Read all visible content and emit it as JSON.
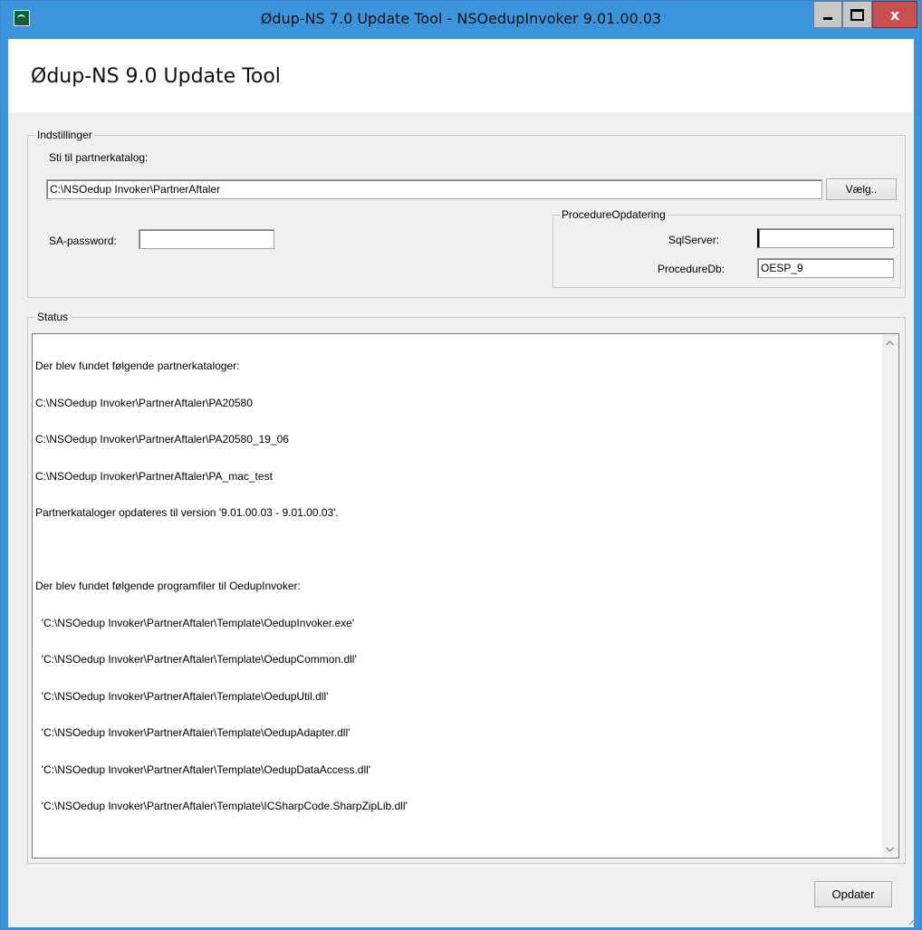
{
  "window": {
    "title": "Ødup-NS 7.0 Update Tool - NSOedupInvoker 9.01.00.03",
    "close_glyph": "x"
  },
  "header": {
    "title": "Ødup-NS 9.0 Update Tool"
  },
  "settings": {
    "legend": "Indstillinger",
    "path_label": "Sti til partnerkatalog:",
    "path_value": "C:\\NSOedup Invoker\\PartnerAftaler",
    "choose_button": "Vælg..",
    "sa_password_label": "SA-password:",
    "sa_password_value": ""
  },
  "procedure": {
    "legend": "ProcedureOpdatering",
    "sqlserver_label": "SqlServer:",
    "sqlserver_value": "",
    "proceduredb_label": "ProcedureDb:",
    "proceduredb_value": "OESP_9"
  },
  "status": {
    "legend": "Status",
    "lines": [
      "Der blev fundet følgende partnerkataloger:",
      "C:\\NSOedup Invoker\\PartnerAftaler\\PA20580",
      "C:\\NSOedup Invoker\\PartnerAftaler\\PA20580_19_06",
      "C:\\NSOedup Invoker\\PartnerAftaler\\PA_mac_test",
      "Partnerkataloger opdateres til version '9.01.00.03 - 9.01.00.03'.",
      "",
      "Der blev fundet følgende programfiler til OedupInvoker:",
      "  'C:\\NSOedup Invoker\\PartnerAftaler\\Template\\OedupInvoker.exe'",
      "  'C:\\NSOedup Invoker\\PartnerAftaler\\Template\\OedupCommon.dll'",
      "  'C:\\NSOedup Invoker\\PartnerAftaler\\Template\\OedupUtil.dll'",
      "  'C:\\NSOedup Invoker\\PartnerAftaler\\Template\\OedupAdapter.dll'",
      "  'C:\\NSOedup Invoker\\PartnerAftaler\\Template\\OedupDataAccess.dll'",
      "  'C:\\NSOedup Invoker\\PartnerAftaler\\Template\\ICSharpCode.SharpZipLib.dll'"
    ]
  },
  "footer": {
    "update_button": "Opdater"
  }
}
